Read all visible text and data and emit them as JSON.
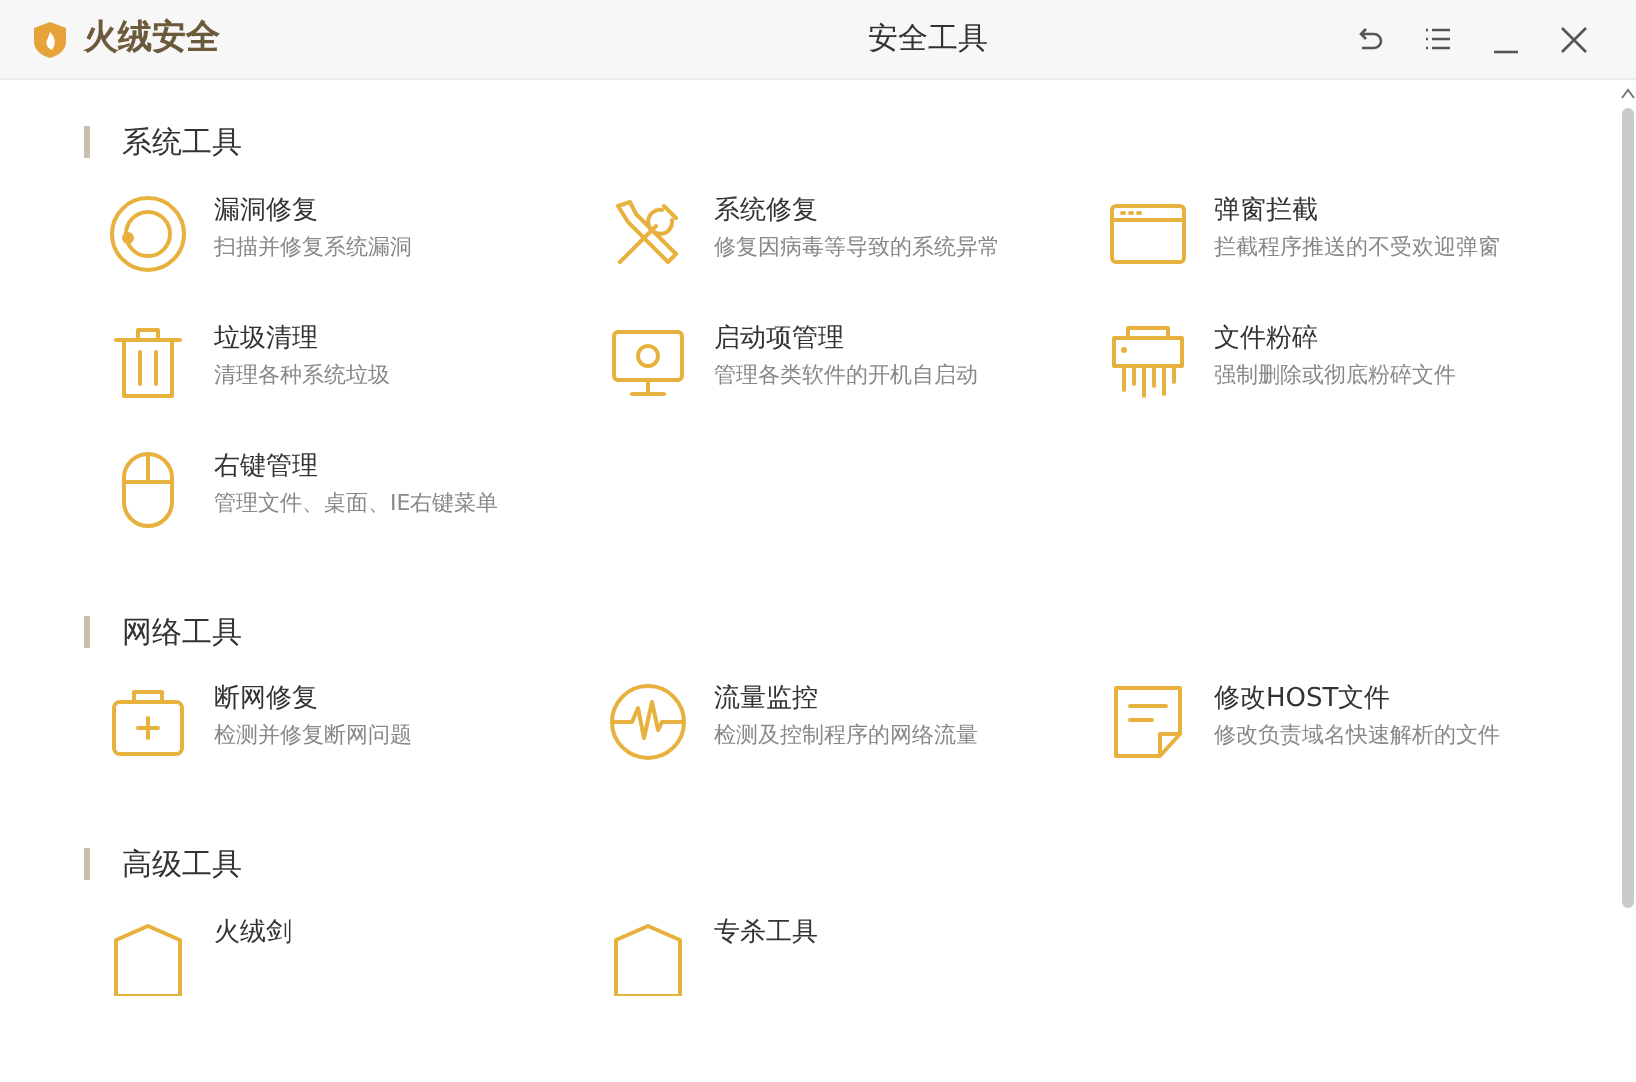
{
  "app": {
    "name": "火绒安全"
  },
  "window": {
    "title": "安全工具"
  },
  "sections": [
    {
      "title": "系统工具",
      "items": [
        {
          "kind": "ring",
          "title": "漏洞修复",
          "desc": "扫描并修复系统漏洞"
        },
        {
          "kind": "tools",
          "title": "系统修复",
          "desc": "修复因病毒等导致的系统异常"
        },
        {
          "kind": "popup",
          "title": "弹窗拦截",
          "desc": "拦截程序推送的不受欢迎弹窗"
        },
        {
          "kind": "trash",
          "title": "垃圾清理",
          "desc": "清理各种系统垃圾"
        },
        {
          "kind": "monitor",
          "title": "启动项管理",
          "desc": "管理各类软件的开机自启动"
        },
        {
          "kind": "shredder",
          "title": "文件粉碎",
          "desc": "强制删除或彻底粉碎文件"
        },
        {
          "kind": "mouse",
          "title": "右键管理",
          "desc": "管理文件、桌面、IE右键菜单"
        }
      ]
    },
    {
      "title": "网络工具",
      "items": [
        {
          "kind": "kit",
          "title": "断网修复",
          "desc": "检测并修复断网问题"
        },
        {
          "kind": "pulse",
          "title": "流量监控",
          "desc": "检测及控制程序的网络流量"
        },
        {
          "kind": "note",
          "title": "修改HOST文件",
          "desc": "修改负责域名快速解析的文件"
        }
      ]
    },
    {
      "title": "高级工具",
      "items": [
        {
          "kind": "shield",
          "title": "火绒剑"
        },
        {
          "kind": "shield",
          "title": "专杀工具"
        }
      ]
    }
  ]
}
